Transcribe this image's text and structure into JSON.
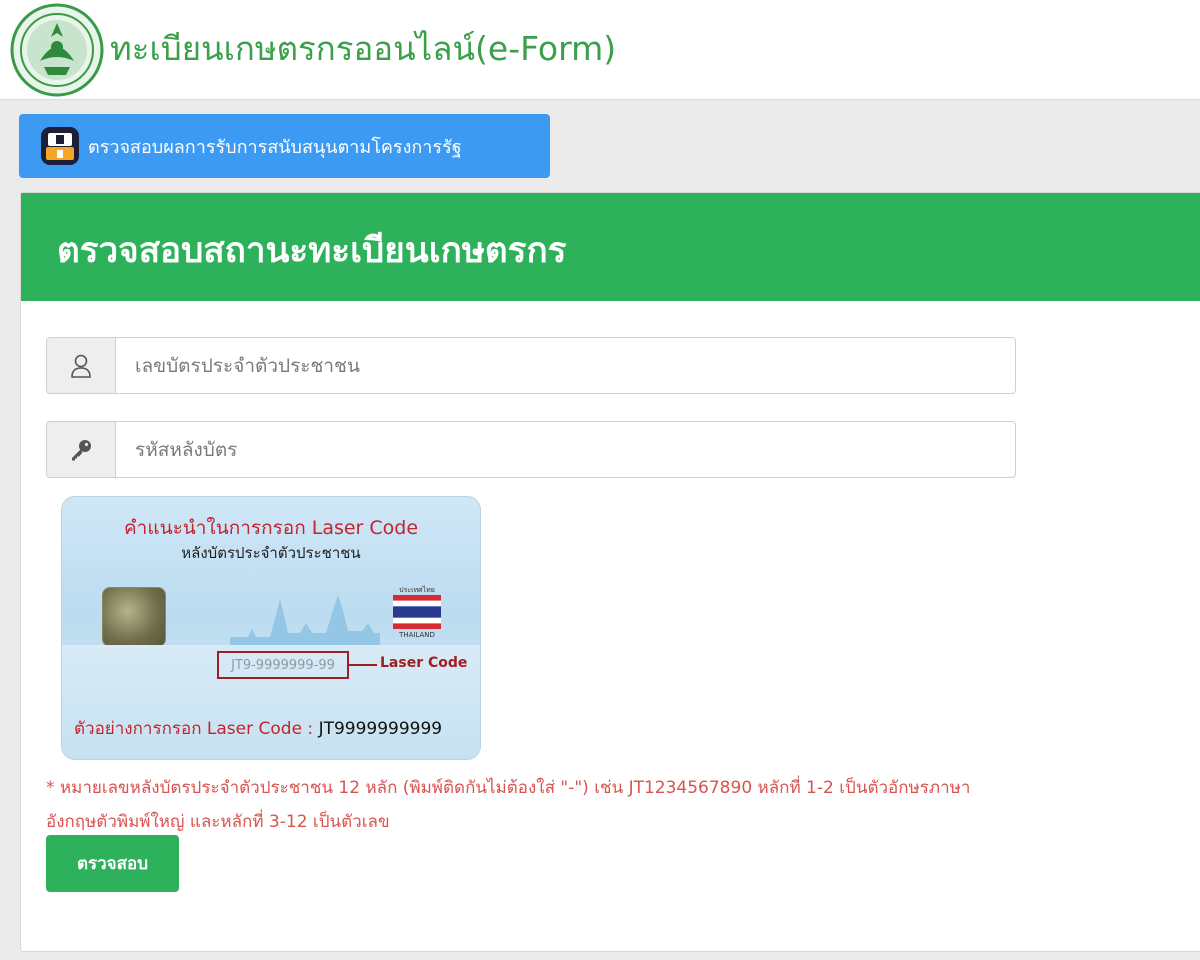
{
  "header": {
    "logo_icon": "ministry-seal-icon",
    "title": "ทะเบียนเกษตรกรออนไลน์(e-Form)"
  },
  "gov_button": {
    "icon": "government-support-icon",
    "label": "ตรวจสอบผลการรับการสนับสนุนตามโครงการรัฐ"
  },
  "panel": {
    "title": "ตรวจสอบสถานะทะเบียนเกษตรกร",
    "id_field": {
      "icon": "user-icon",
      "placeholder": "เลขบัตรประจำตัวประชาชน",
      "value": ""
    },
    "laser_field": {
      "icon": "key-icon",
      "placeholder": "รหัสหลังบัตร",
      "value": ""
    },
    "card_image": {
      "title": "คำแนะนำในการกรอก Laser Code",
      "subtitle": "หลังบัตรประจำตัวประชาชน",
      "flag_caption": "ประเทศไทย",
      "flag_label": "THAILAND",
      "code_sample": "JT9-9999999-99",
      "code_label": "Laser Code",
      "example_label": "ตัวอย่างการกรอก Laser Code :",
      "example_value": "JT9999999999"
    },
    "note": "* หมายเลขหลังบัตรประจำตัวประชาชน 12 หลัก (พิมพ์ติดกันไม่ต้องใส่ \"-\") เช่น JT1234567890 หลักที่ 1-2 เป็นตัวอักษรภาษาอังกฤษตัวพิมพ์ใหญ่ และหลักที่ 3-12 เป็นตัวเลข",
    "submit_label": "ตรวจสอบ"
  },
  "colors": {
    "brand_green": "#2eb15b",
    "title_green": "#3aa04a",
    "info_blue": "#3d9af2",
    "warning_red": "#d9534f"
  }
}
